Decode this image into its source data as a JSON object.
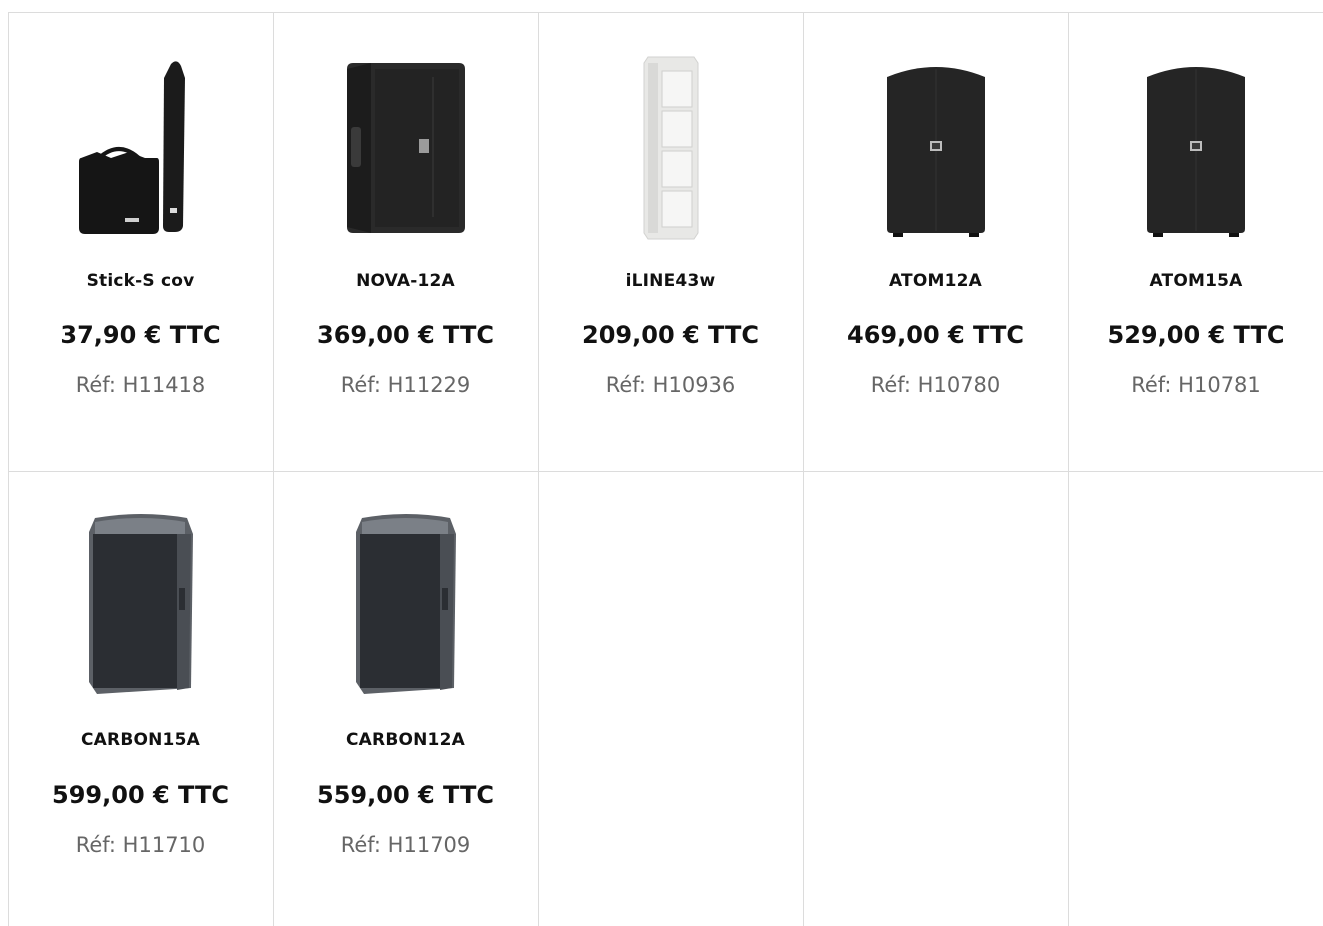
{
  "products": [
    {
      "name": "Stick-S cov",
      "price": "37,90 € TTC",
      "ref": "Réf: H11418",
      "image": "cover-bags-image"
    },
    {
      "name": "NOVA-12A",
      "price": "369,00 € TTC",
      "ref": "Réf: H11229",
      "image": "speaker-black-image"
    },
    {
      "name": "iLINE43w",
      "price": "209,00 € TTC",
      "ref": "Réf: H10936",
      "image": "column-speaker-white-image"
    },
    {
      "name": "ATOM12A",
      "price": "469,00 € TTC",
      "ref": "Réf: H10780",
      "image": "speaker-black-image"
    },
    {
      "name": "ATOM15A",
      "price": "529,00 € TTC",
      "ref": "Réf: H10781",
      "image": "speaker-black-image"
    },
    {
      "name": "CARBON15A",
      "price": "599,00 € TTC",
      "ref": "Réf: H11710",
      "image": "speaker-grey-image"
    },
    {
      "name": "CARBON12A",
      "price": "559,00 € TTC",
      "ref": "Réf: H11709",
      "image": "speaker-grey-image"
    }
  ]
}
